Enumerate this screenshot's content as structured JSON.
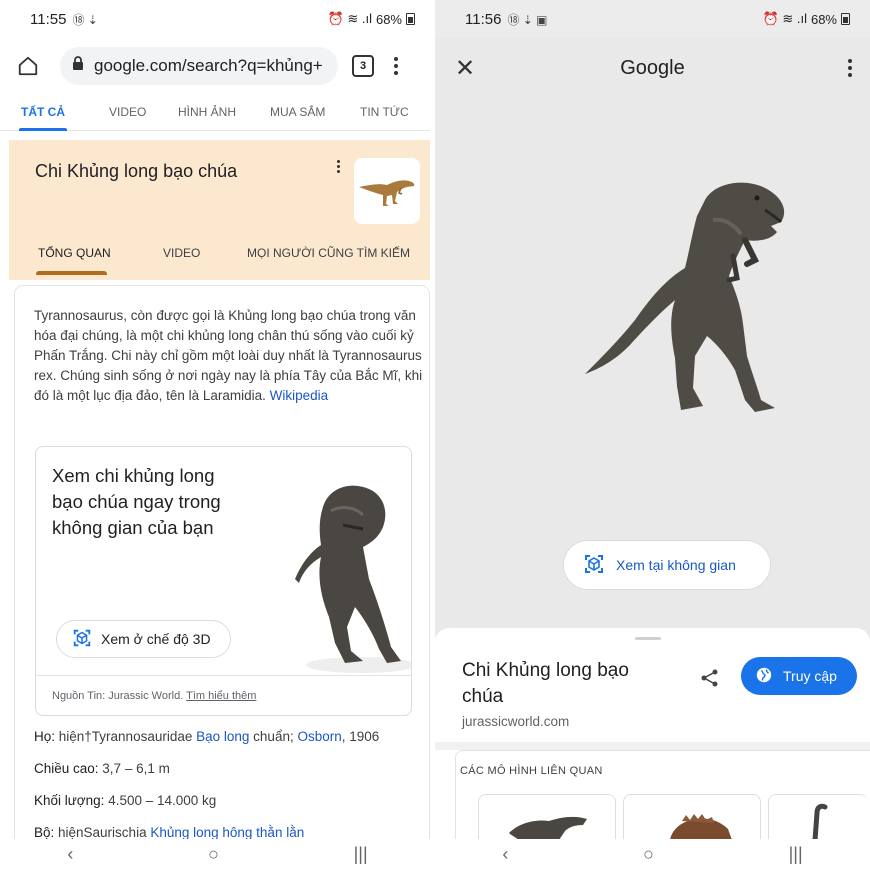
{
  "left": {
    "status": {
      "time": "11:55",
      "icons": "⑱ ⇣",
      "signal": "⏰ ≋ .ıl",
      "battery": "68%"
    },
    "url": {
      "text": "google.com/search?q=khủng+",
      "tabs_count": "3"
    },
    "search_tabs": [
      "TẤT CẢ",
      "VIDEO",
      "HÌNH ẢNH",
      "MUA SẮM",
      "TIN TỨC"
    ],
    "knowledge_panel": {
      "title": "Chi Khủng long bạo chúa",
      "tabs": [
        "TỔNG QUAN",
        "VIDEO",
        "MỌI NGƯỜI CŨNG TÌM KIẾM"
      ]
    },
    "description": {
      "text": "Tyrannosaurus, còn được gọi là Khủng long bạo chúa trong văn hóa đại chúng, là một chi khủng long chân thú sống vào cuối kỷ Phấn Trắng. Chi này chỉ gồm một loài duy nhất là Tyrannosaurus rex. Chúng sinh sống ở nơi ngày nay là phía Tây của Bắc Mĩ, khi đó là một lục địa đảo, tên là Laramidia.",
      "link": "Wikipedia"
    },
    "ar_card": {
      "text": "Xem chi khủng long bạo chúa ngay trong không gian của bạn",
      "button": "Xem ở chế độ 3D",
      "source_prefix": "Nguồn Tin: Jurassic World.",
      "source_link": "Tìm hiểu thêm"
    },
    "facts": [
      {
        "label": "Họ:",
        "value": " hiện†Tyrannosauridae ",
        "link": "Bạo long",
        "rest": " chuẩn; ",
        "link2": "Osborn",
        "rest2": ", 1906"
      },
      {
        "label": "Chiều cao:",
        "value": " 3,7 – 6,1 m"
      },
      {
        "label": "Khối lượng:",
        "value": " 4.500 – 14.000 kg"
      },
      {
        "label": "Bộ:",
        "value": " hiệnSaurischia ",
        "link": "Khủng long hông thằn lằn"
      }
    ],
    "nav": [
      "‹",
      "○",
      "|||"
    ]
  },
  "right": {
    "status": {
      "time": "11:56",
      "icons": "⑱ ⇣ ▣",
      "signal": "⏰ ≋ .ıl",
      "battery": "68%"
    },
    "title": "Google",
    "space_button": "Xem tại không gian",
    "sheet": {
      "title": "Chi Khủng long bạo chúa",
      "site": "jurassicworld.com",
      "visit_button": "Truy cập",
      "related_heading": "CÁC MÔ HÌNH LIÊN QUAN"
    },
    "nav": [
      "‹",
      "○",
      "|||"
    ]
  }
}
